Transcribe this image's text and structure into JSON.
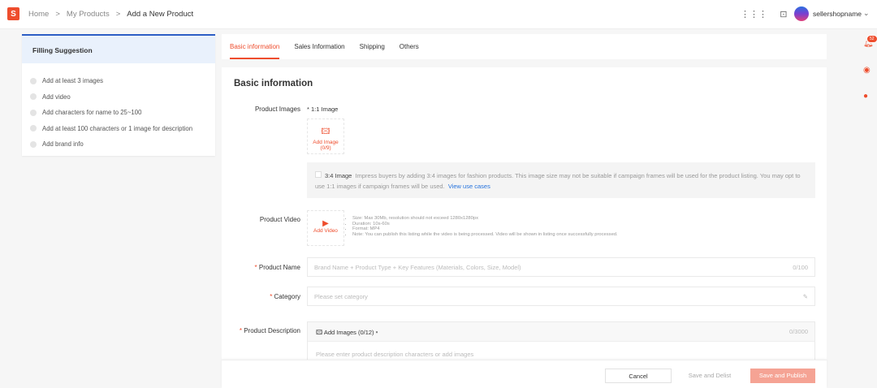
{
  "header": {
    "logo": "S",
    "breadcrumb": [
      "Home",
      "My Products",
      "Add a New Product"
    ],
    "separator": ">",
    "username": "sellershopname",
    "icons": [
      "apps-grid-icon",
      "book-icon",
      "chevron-down-icon"
    ]
  },
  "suggestion": {
    "title": "Filling Suggestion",
    "items": [
      "Add at least 3 images",
      "Add video",
      "Add characters for name to 25~100",
      "Add at least 100 characters or 1 image for description",
      "Add brand info"
    ]
  },
  "tabs": [
    {
      "label": "Basic information",
      "active": true
    },
    {
      "label": "Sales Information"
    },
    {
      "label": "Shipping"
    },
    {
      "label": "Others"
    }
  ],
  "form": {
    "title": "Basic information",
    "images_label": "Product Images",
    "images_ratio": "* 1:1 Image",
    "add_image": "Add Image",
    "add_image_count": "(0/9)",
    "ratio34_label": "3:4 Image",
    "ratio34_text": "Impress buyers by adding 3:4 images for fashion products. This image size may not be suitable if campaign frames will be used for the product listing. You may opt to use 1:1 images if campaign frames will be used.",
    "ratio34_link": "View use cases",
    "video_label": "Product Video",
    "add_video": "Add Video",
    "video_info": [
      "Size: Max 30Mb, resolution should not exceed 1280x1280px",
      "Duration: 10s-60s",
      "Format: MP4",
      "Note: You can publish this listing while the video is being processed. Video will be shown in listing once successfully processed."
    ],
    "name_label": "Product Name",
    "name_placeholder": "Brand Name + Product Type + Key Features (Materials, Colors, Size, Model)",
    "name_count": "0/100",
    "category_label": "Category",
    "category_placeholder": "Please set category",
    "desc_label": "Product Description",
    "desc_add_images": "Add Images (0/12)",
    "desc_count": "0/3000",
    "desc_placeholder": "Please enter product description characters or add images"
  },
  "footer": {
    "cancel": "Cancel",
    "save_delist": "Save and Delist",
    "save_publish": "Save and Publish"
  },
  "side": {
    "notification_count": "52"
  },
  "colors": {
    "accent": "#ee4d2d",
    "link": "#2673dd",
    "suggestion_border": "#2d5ec5"
  }
}
